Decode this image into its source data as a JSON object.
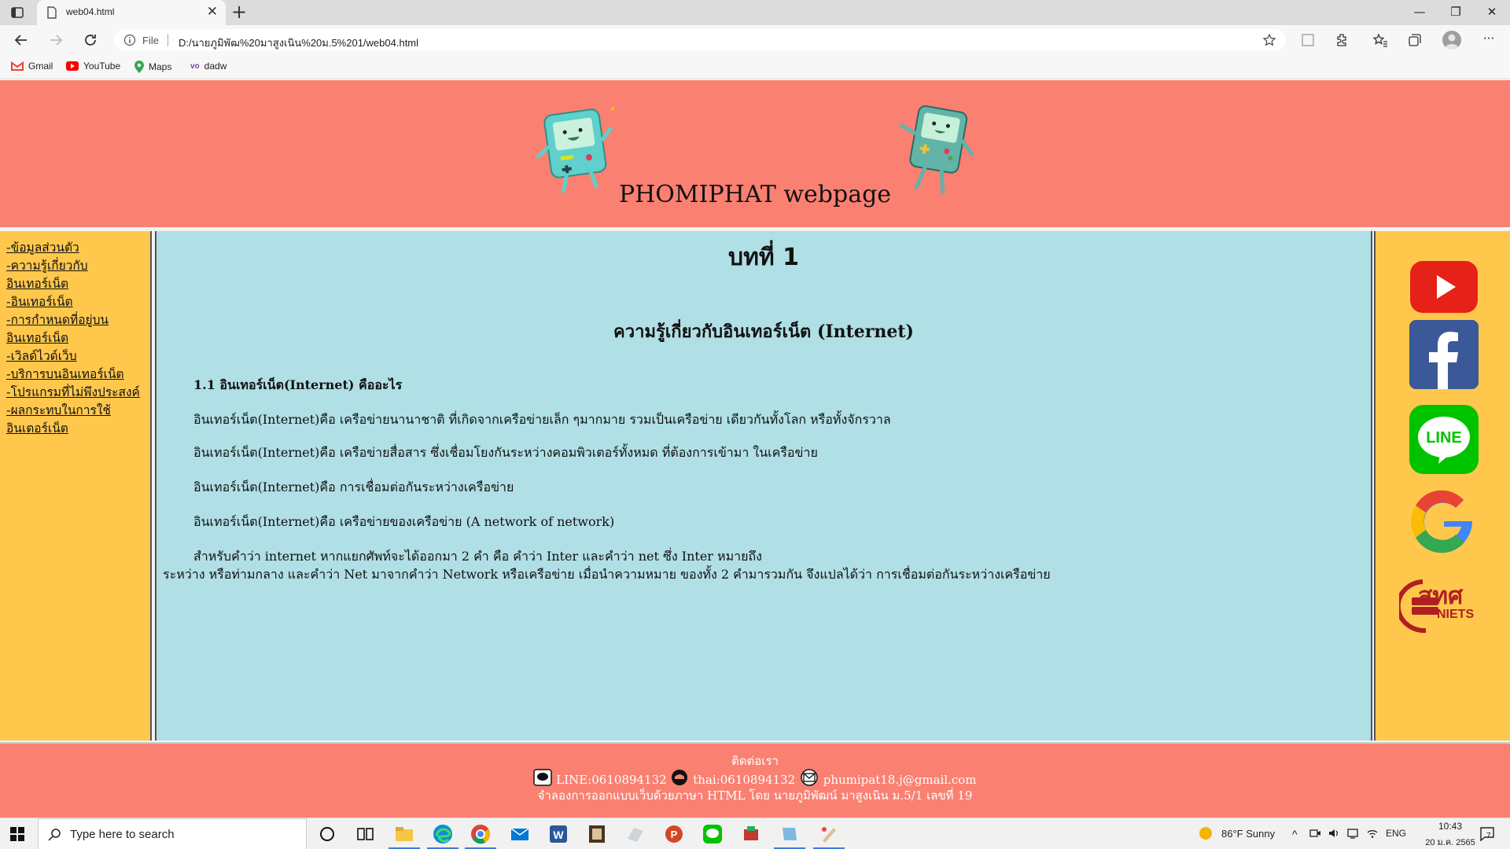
{
  "browser": {
    "tab_title": "web04.html",
    "url_scheme": "File",
    "url": "D:/นายภูมิพัฒ%20มาสูงเนิน%20ม.5%201/web04.html",
    "bookmarks": [
      "Gmail",
      "YouTube",
      "Maps",
      "dadw"
    ]
  },
  "header": {
    "title": "PHOMIPHAT webpage"
  },
  "sidebar": {
    "items": [
      {
        "label": "-ข้อมูลส่วนตัว"
      },
      {
        "label": "-ความรู้เกี่ยวกับอินเทอร์เน็ต"
      },
      {
        "label": "-อินเทอร์เน็ต"
      },
      {
        "label": "-การกำหนดที่อยู่บนอินเทอร์เน็ต"
      },
      {
        "label": "-เวิลด์ไวด์เว็บ"
      },
      {
        "label": "-บริการบนอินเทอร์เน็ต"
      },
      {
        "label": "-โปรแกรมที่ไม่พึงประสงค์"
      },
      {
        "label": "-ผลกระทบในการใช้อินเตอร์เน็ต"
      }
    ]
  },
  "main": {
    "chapter": "บทที่ 1",
    "subtitle": "ความรู้เกี่ยวกับอินเทอร์เน็ต (Internet)",
    "section": "1.1 อินเทอร์เน็ต(Internet) คืออะไร",
    "p1": "อินเทอร์เน็ต(Internet)คือ เครือข่ายนานาชาติ ที่เกิดจากเครือข่ายเล็ก ๆมากมาย รวมเป็นเครือข่าย เดียวกันทั้งโลก หรือทั้งจักรวาล",
    "p2": "อินเทอร์เน็ต(Internet)คือ เครือข่ายสื่อสาร ซึ่งเชื่อมโยงกันระหว่างคอมพิวเตอร์ทั้งหมด ที่ต้องการเข้ามา ในเครือข่าย",
    "p3": "อินเทอร์เน็ต(Internet)คือ การเชื่อมต่อกันระหว่างเครือข่าย",
    "p4": "อินเทอร์เน็ต(Internet)คือ เครือข่ายของเครือข่าย (A network of network)",
    "p5a": "สำหรับคำว่า internet หากแยกศัพท์จะได้ออกมา 2 คำ คือ คำว่า Inter และคำว่า net ซึ่ง Inter หมายถึง",
    "p5b": "ระหว่าง หรือท่ามกลาง และคำว่า Net มาจากคำว่า Network หรือเครือข่าย เมื่อนำความหมาย ของทั้ง 2 คำมารวมกัน จึงแปลได้ว่า การเชื่อมต่อกันระหว่างเครือข่าย"
  },
  "social": {
    "icons": [
      "youtube-icon",
      "facebook-icon",
      "line-icon",
      "google-icon",
      "niets-logo"
    ],
    "niets_text": "สทศ",
    "niets_sub": "NIETS"
  },
  "footer": {
    "contact_heading": "ติดต่อเรา",
    "line": "LINE:0610894132",
    "phone": "thai:0610894132",
    "email": "phumipat18.j@gmail.com",
    "credit": "จำลองการออกแบบเว็บด้วยภาษา HTML โดย นายภูมิพัฒน์ มาสูงเนิน ม.5/1 เลขที่ 19"
  },
  "taskbar": {
    "search_placeholder": "Type here to search",
    "weather": "86°F  Sunny",
    "lang": "ENG",
    "time": "10:43",
    "date": "20 ม.ค. 2565",
    "notification_count": "7"
  },
  "colors": {
    "header_bg": "#fa8072",
    "side_bg": "#ffc84d",
    "main_bg": "#b0dfe5"
  }
}
